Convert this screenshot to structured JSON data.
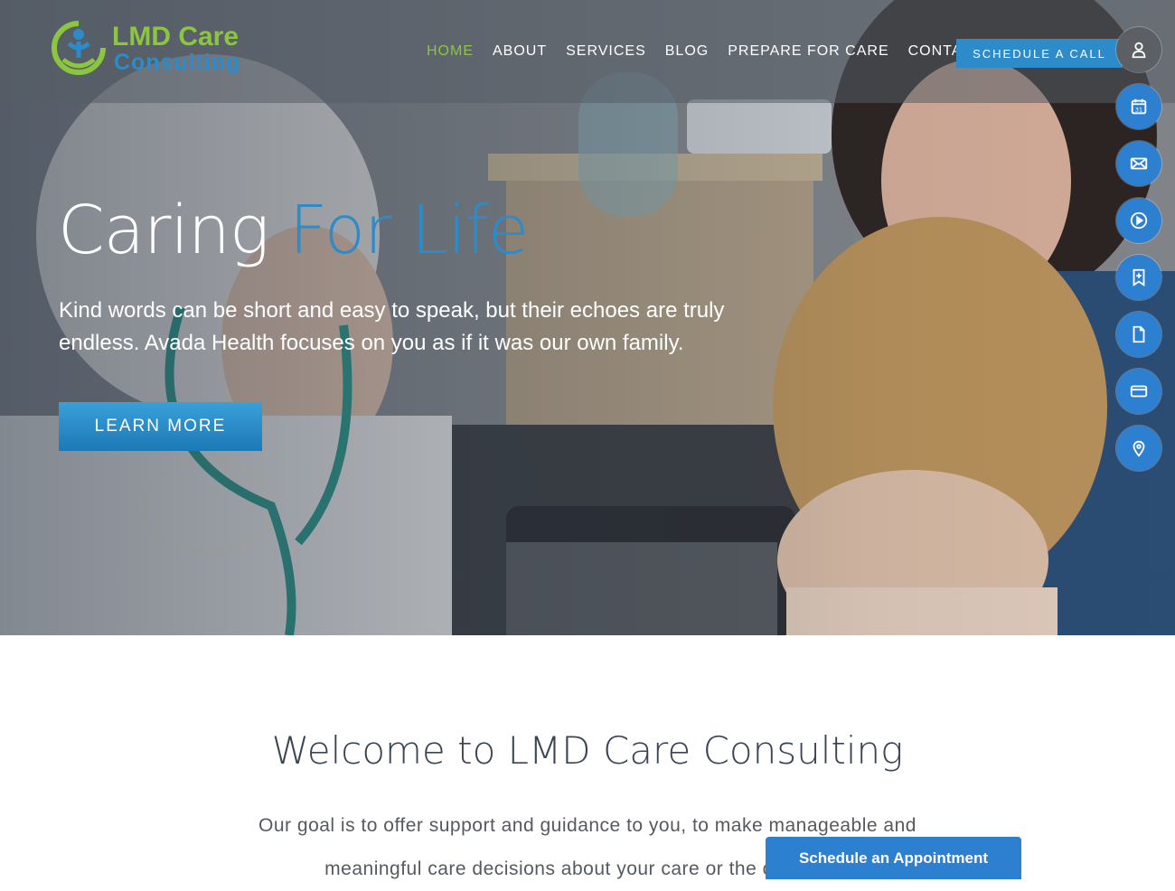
{
  "brand": {
    "name_line1": "LMD Care",
    "name_line2": "Consulting",
    "color_green": "#8cc63f",
    "color_blue": "#2d8bc9"
  },
  "nav": {
    "items": [
      {
        "label": "HOME",
        "active": true
      },
      {
        "label": "ABOUT",
        "active": false
      },
      {
        "label": "SERVICES",
        "active": false
      },
      {
        "label": "BLOG",
        "active": false
      },
      {
        "label": "PREPARE FOR CARE",
        "active": false
      },
      {
        "label": "CONTACT",
        "active": false
      }
    ],
    "cta_label": "SCHEDULE A CALL"
  },
  "hero": {
    "title_main": "Caring",
    "title_accent": "For Life",
    "text": "Kind words can be short and easy to speak, but their echoes are truly endless. Avada Health focuses on you as if it was our own family.",
    "button_label": "LEARN MORE"
  },
  "side_icons": [
    {
      "name": "user-icon"
    },
    {
      "name": "calendar-icon"
    },
    {
      "name": "mail-icon"
    },
    {
      "name": "play-icon"
    },
    {
      "name": "bookmark-icon"
    },
    {
      "name": "document-icon"
    },
    {
      "name": "credit-card-icon"
    },
    {
      "name": "location-pin-icon"
    }
  ],
  "welcome": {
    "title": "Welcome to LMD Care Consulting",
    "text": "Our goal is to offer support and guidance to you, to make manageable and meaningful care decisions about your care or the care of yo"
  },
  "appointment_tab": {
    "label": "Schedule an Appointment"
  }
}
